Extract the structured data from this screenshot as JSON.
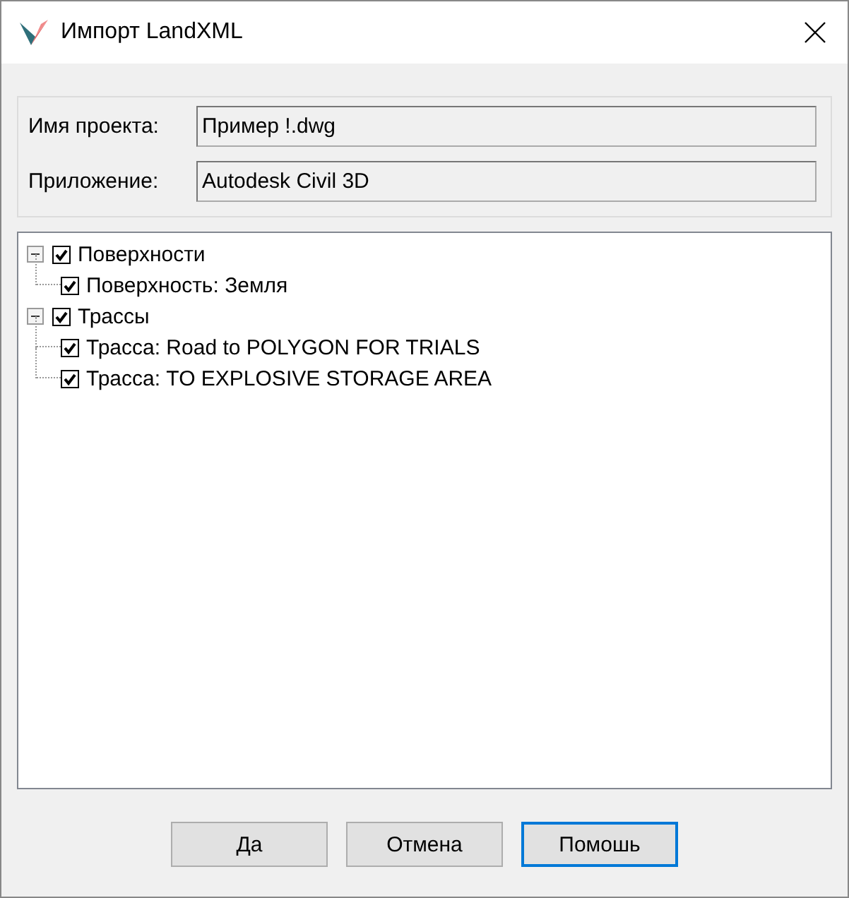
{
  "window": {
    "title": "Импорт LandXML"
  },
  "fields": [
    {
      "label": "Имя проекта:",
      "value": "Пример !.dwg"
    },
    {
      "label": "Приложение:",
      "value": "Autodesk Civil 3D"
    }
  ],
  "tree": [
    {
      "label": "Поверхности",
      "checked": true,
      "expanded": true,
      "children": [
        {
          "label": "Поверхность: Земля",
          "checked": true
        }
      ]
    },
    {
      "label": "Трассы",
      "checked": true,
      "expanded": true,
      "children": [
        {
          "label": "Трасса: Road to POLYGON FOR TRIALS",
          "checked": true
        },
        {
          "label": "Трасса: TO EXPLOSIVE STORAGE AREA",
          "checked": true
        }
      ]
    }
  ],
  "buttons": [
    {
      "label": "Да",
      "focused": false
    },
    {
      "label": "Отмена",
      "focused": false
    },
    {
      "label": "Помошь",
      "focused": true
    }
  ]
}
